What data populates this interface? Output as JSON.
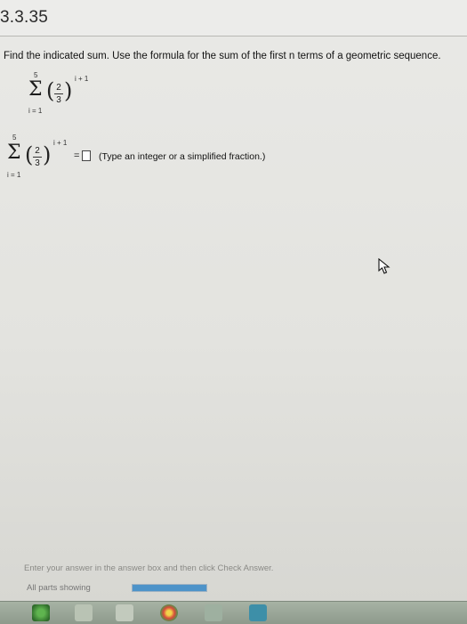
{
  "header": {
    "problem_number": "3.3.35"
  },
  "instruction": "Find the indicated sum. Use the formula for the sum of the first n terms of a geometric sequence.",
  "expression": {
    "upper_limit": "5",
    "lower_limit": "i = 1",
    "fraction_numerator": "2",
    "fraction_denominator": "3",
    "exponent": "i + 1"
  },
  "answer": {
    "equals": "=",
    "value": "",
    "hint": "(Type an integer or a simplified fraction.)"
  },
  "footer": {
    "hint": "Enter your answer in the answer box and then click Check Answer.",
    "parts_label": "All parts showing",
    "progress_percent": 100
  },
  "icons": {
    "cursor": "mouse-pointer-icon"
  }
}
